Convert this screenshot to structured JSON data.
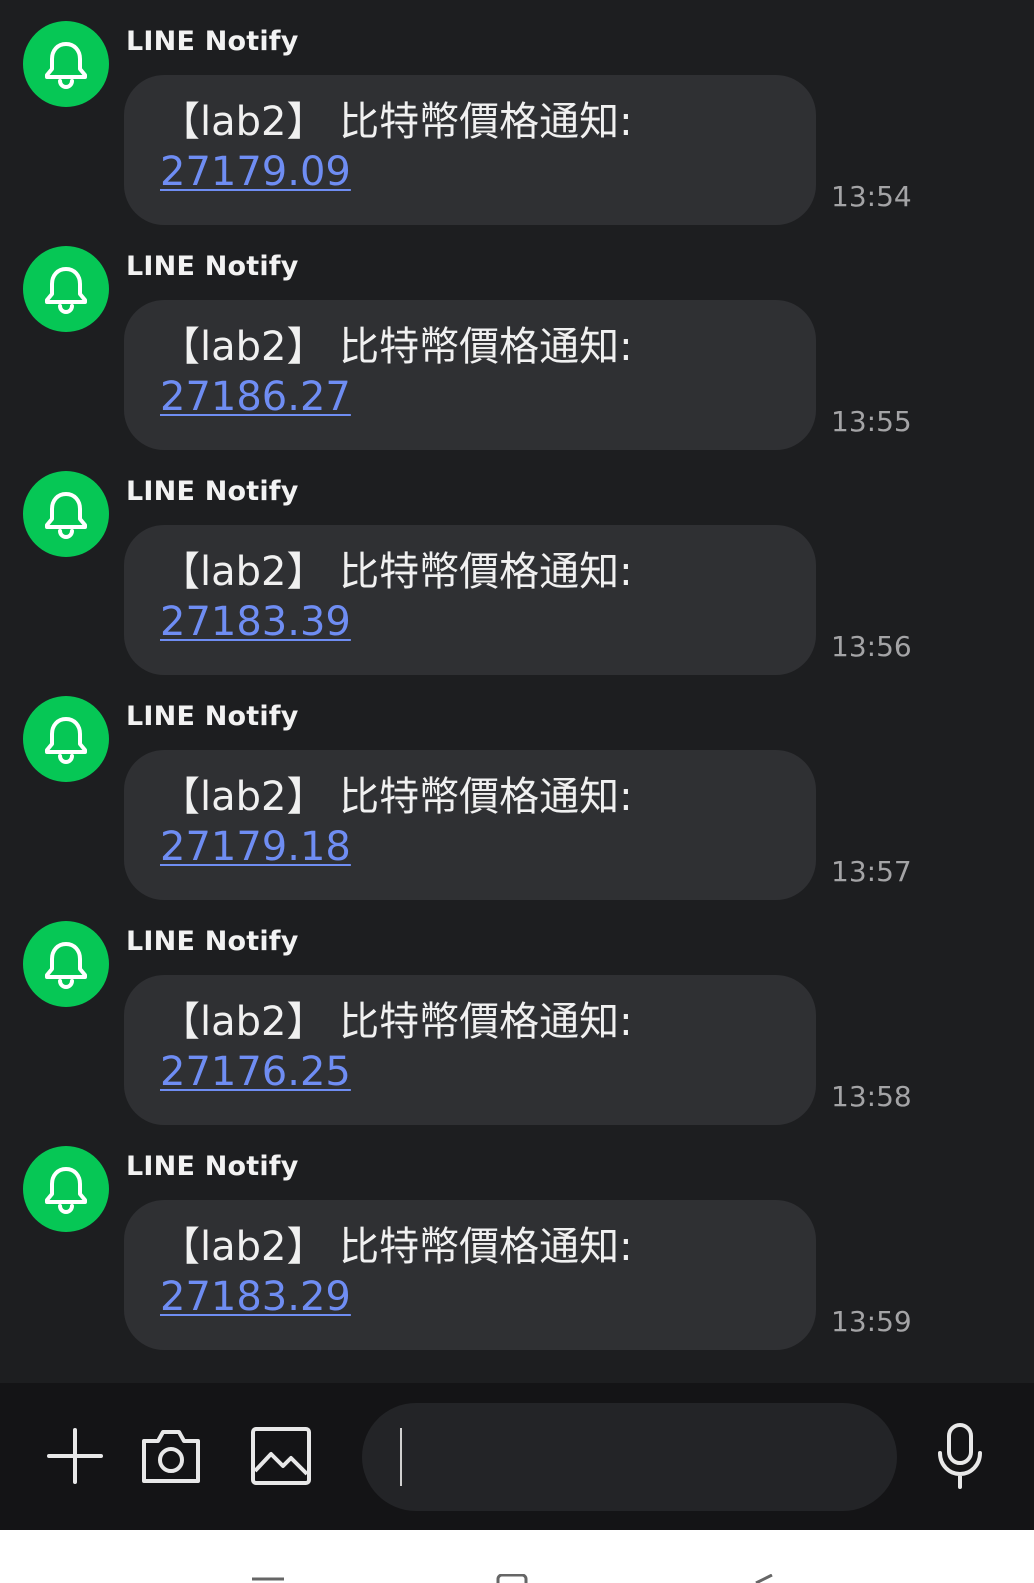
{
  "messages": [
    {
      "sender": "LINE Notify",
      "text": "【lab2】 比特幣價格通知:",
      "price": "27179.09",
      "time": "13:54"
    },
    {
      "sender": "LINE Notify",
      "text": "【lab2】 比特幣價格通知:",
      "price": "27186.27",
      "time": "13:55"
    },
    {
      "sender": "LINE Notify",
      "text": "【lab2】 比特幣價格通知:",
      "price": "27183.39",
      "time": "13:56"
    },
    {
      "sender": "LINE Notify",
      "text": "【lab2】 比特幣價格通知:",
      "price": "27179.18",
      "time": "13:57"
    },
    {
      "sender": "LINE Notify",
      "text": "【lab2】 比特幣價格通知:",
      "price": "27176.25",
      "time": "13:58"
    },
    {
      "sender": "LINE Notify",
      "text": "【lab2】 比特幣價格通知:",
      "price": "27183.29",
      "time": "13:59"
    }
  ],
  "input_bar": {
    "message_value": "",
    "message_placeholder": "",
    "icons": [
      "plus-icon",
      "camera-icon",
      "image-icon",
      "emoji-icon",
      "microphone-icon"
    ]
  },
  "navigation_bar": {
    "icons": [
      "recent-apps-icon",
      "home-icon",
      "back-icon"
    ]
  },
  "colors": {
    "chat_background": "#1d1e20",
    "bubble": "#2f3033",
    "avatar": "#06c755",
    "link": "#6f8df3",
    "timestamp": "#a4a4a6",
    "input_bar": "#141416"
  }
}
